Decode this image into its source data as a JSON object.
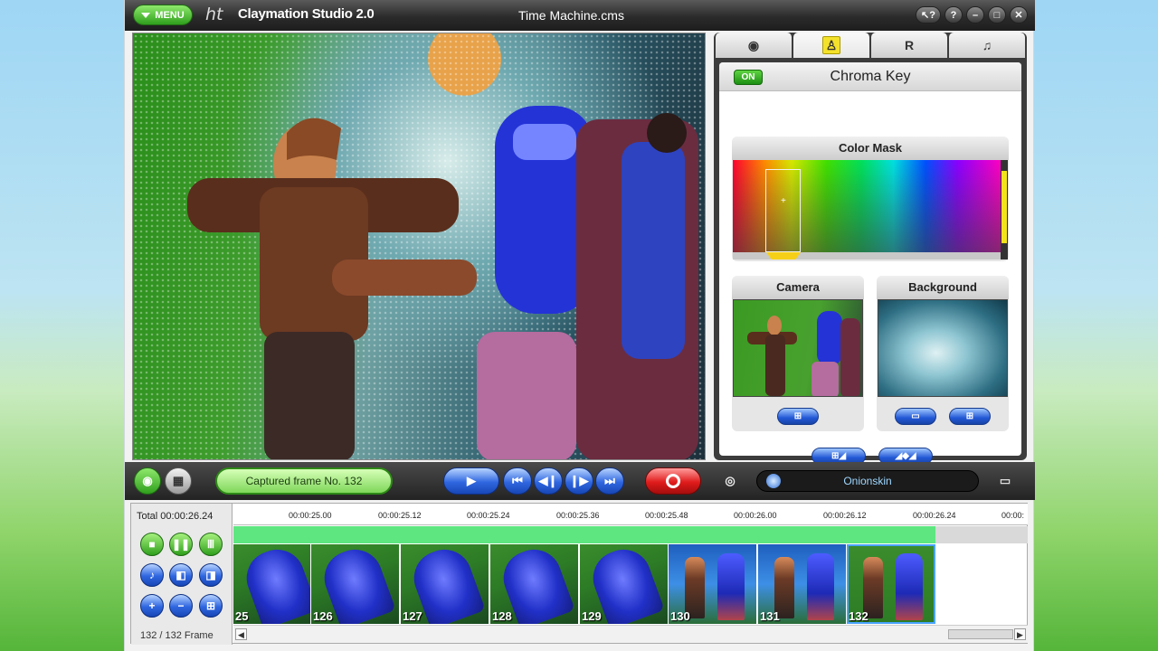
{
  "titlebar": {
    "menu_label": "MENU",
    "logo_mark": "ht",
    "app_title": "Claymation Studio 2.0",
    "doc_title": "Time Machine.cms",
    "window_buttons": [
      "help-context",
      "help",
      "minimize",
      "maximize",
      "close"
    ]
  },
  "tabs": [
    {
      "icon": "camera-icon",
      "active": false
    },
    {
      "icon": "chroma-key-icon",
      "active": true
    },
    {
      "icon": "render-icon",
      "active": false
    },
    {
      "icon": "music-icon",
      "active": false
    }
  ],
  "chroma_key": {
    "on_label": "ON",
    "title": "Chroma Key",
    "color_mask_label": "Color Mask",
    "camera_label": "Camera",
    "background_label": "Background"
  },
  "transport": {
    "status": "Captured frame No. 132",
    "onionskin_label": "Onionskin"
  },
  "timeline": {
    "total": "Total 00:00:26.24",
    "frame_count": "132 / 132 Frame",
    "ticks": [
      "00:00:25.00",
      "00:00:25.12",
      "00:00:25.24",
      "00:00:25.36",
      "00:00:25.48",
      "00:00:26.00",
      "00:00:26.12",
      "00:00:26.24",
      "00:00:"
    ],
    "frames": [
      {
        "number": "25",
        "kind": "robot"
      },
      {
        "number": "126",
        "kind": "robot"
      },
      {
        "number": "127",
        "kind": "robot"
      },
      {
        "number": "128",
        "kind": "robot"
      },
      {
        "number": "129",
        "kind": "robot"
      },
      {
        "number": "130",
        "kind": "scene"
      },
      {
        "number": "131",
        "kind": "scene"
      },
      {
        "number": "132",
        "kind": "scene-selected"
      }
    ]
  },
  "colors": {
    "accent_green": "#2f9f1c",
    "accent_blue": "#2f66e0",
    "record_red": "#e01b1b",
    "timeline_green": "#5ee680"
  }
}
